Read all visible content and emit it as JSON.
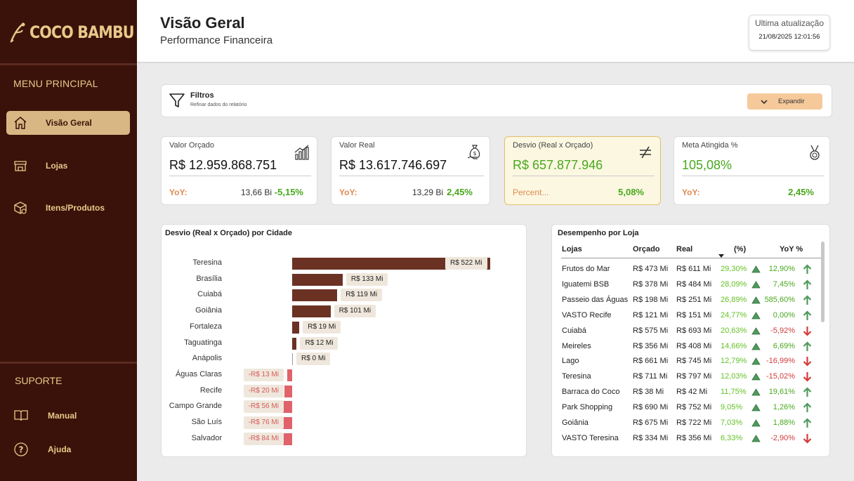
{
  "sidebar": {
    "logo_text": "COCO BAMBU",
    "menu_title": "MENU PRINCIPAL",
    "items": [
      {
        "label": "Visão Geral",
        "icon": "home-icon",
        "active": true
      },
      {
        "label": "Lojas",
        "icon": "store-icon"
      },
      {
        "label": "Itens/Produtos",
        "icon": "box-icon"
      }
    ],
    "support_title": "SUPORTE",
    "support_items": [
      {
        "label": "Manual",
        "icon": "book-icon"
      },
      {
        "label": "Ajuda",
        "icon": "help-icon"
      }
    ]
  },
  "header": {
    "title": "Visão Geral",
    "subtitle": "Performance Financeira",
    "update_label": "Ultima atualização",
    "update_value": "21/08/2025 12:01:56"
  },
  "filters": {
    "title": "Filtros",
    "subtitle": "Refinar dados do relatório",
    "expand_label": "Expandir"
  },
  "kpis": [
    {
      "label": "Valor Orçado",
      "value": "R$ 12.959.868.751",
      "yoy_label": "YoY:",
      "prev": "13,66 Bi",
      "delta": "-5,15%"
    },
    {
      "label": "Valor Real",
      "value": "R$ 13.617.746.697",
      "yoy_label": "YoY:",
      "prev": "13,29 Bi",
      "delta": "2,45%"
    },
    {
      "label": "Desvio (Real x Orçado)",
      "value": "R$ 657.877.946",
      "yoy_label": "Percent...",
      "prev": "",
      "delta": "5,08%"
    },
    {
      "label": "Meta Atingida %",
      "value": "105,08%",
      "yoy_label": "YoY:",
      "prev": "",
      "delta": "2,45%"
    }
  ],
  "city_chart": {
    "title": "Desvio (Real x Orçado) por Cidade",
    "colors": {
      "positive": "#6b3224",
      "negative": "#e0626b"
    }
  },
  "chart_data": {
    "type": "bar",
    "orientation": "horizontal",
    "title": "Desvio (Real x Orçado) por Cidade",
    "unit": "R$ Mi",
    "categories": [
      "Teresina",
      "Brasília",
      "Cuiabá",
      "Goiânia",
      "Fortaleza",
      "Taguatinga",
      "Anápolis",
      "Águas Claras",
      "Recife",
      "Campo Grande",
      "São Luís",
      "Salvador"
    ],
    "values": [
      522,
      133,
      119,
      101,
      19,
      12,
      0,
      -13,
      -20,
      -56,
      -76,
      -84
    ],
    "labels": [
      "R$ 522 Mi",
      "R$ 133 Mi",
      "R$ 119 Mi",
      "R$ 101 Mi",
      "R$ 19 Mi",
      "R$ 12 Mi",
      "R$ 0 Mi",
      "-R$ 13 Mi",
      "-R$ 20 Mi",
      "-R$ 56 Mi",
      "-R$ 76 Mi",
      "-R$ 84 Mi"
    ]
  },
  "store_table": {
    "title": "Desempenho por Loja",
    "columns": [
      "Lojas",
      "Orçado",
      "Real",
      "(%)",
      "YoY %"
    ],
    "rows": [
      {
        "loja": "Frutos do Mar",
        "orcado": "R$ 473 Mi",
        "real": "R$ 611 Mi",
        "pct": "29,30%",
        "yoy": "12,90%",
        "up": true
      },
      {
        "loja": "Iguatemi BSB",
        "orcado": "R$ 378 Mi",
        "real": "R$ 484 Mi",
        "pct": "28,09%",
        "yoy": "7,45%",
        "up": true
      },
      {
        "loja": "Passeio das Águas",
        "orcado": "R$ 198 Mi",
        "real": "R$ 251 Mi",
        "pct": "26,89%",
        "yoy": "585,60%",
        "up": true
      },
      {
        "loja": "VASTO Recife",
        "orcado": "R$ 121 Mi",
        "real": "R$ 151 Mi",
        "pct": "24,77%",
        "yoy": "0,00%",
        "up": true
      },
      {
        "loja": "Cuiabá",
        "orcado": "R$ 575 Mi",
        "real": "R$ 693 Mi",
        "pct": "20,63%",
        "yoy": "-5,92%",
        "up": false
      },
      {
        "loja": "Meireles",
        "orcado": "R$ 356 Mi",
        "real": "R$ 408 Mi",
        "pct": "14,66%",
        "yoy": "6,69%",
        "up": true
      },
      {
        "loja": "Lago",
        "orcado": "R$ 661 Mi",
        "real": "R$ 745 Mi",
        "pct": "12,79%",
        "yoy": "-16,99%",
        "up": false
      },
      {
        "loja": "Teresina",
        "orcado": "R$ 711 Mi",
        "real": "R$ 797 Mi",
        "pct": "12,03%",
        "yoy": "-15,02%",
        "up": false
      },
      {
        "loja": "Barraca do Coco",
        "orcado": "R$ 38 Mi",
        "real": "R$ 42 Mi",
        "pct": "11,75%",
        "yoy": "19,61%",
        "up": true
      },
      {
        "loja": "Park Shopping",
        "orcado": "R$ 690 Mi",
        "real": "R$ 752 Mi",
        "pct": "9,05%",
        "yoy": "1,26%",
        "up": true
      },
      {
        "loja": "Goiânia",
        "orcado": "R$ 675 Mi",
        "real": "R$ 722 Mi",
        "pct": "7,03%",
        "yoy": "1,88%",
        "up": true
      },
      {
        "loja": "VASTO Teresina",
        "orcado": "R$ 334 Mi",
        "real": "R$ 356 Mi",
        "pct": "6,33%",
        "yoy": "-2,90%",
        "up": false
      }
    ]
  }
}
